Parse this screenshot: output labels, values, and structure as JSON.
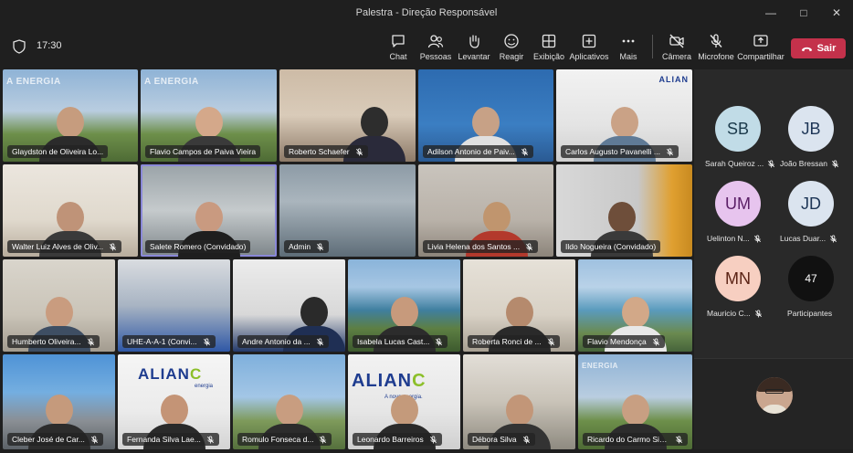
{
  "window": {
    "title": "Palestra - Direção Responsável"
  },
  "toolbar": {
    "time": "17:30",
    "buttons": {
      "chat": "Chat",
      "people": "Pessoas",
      "raise": "Levantar",
      "react": "Reagir",
      "view": "Exibição",
      "apps": "Aplicativos",
      "more": "Mais",
      "camera": "Câmera",
      "mic": "Microfone",
      "share": "Compartilhar"
    },
    "leave_label": "Sair"
  },
  "colors": {
    "accent": "#8a88d8",
    "leave": "#c4314b",
    "muted_mic": "#ffffff"
  },
  "tiles": [
    {
      "name": "Glaydston de Oliveira Lo..."
    },
    {
      "name": "Flavio Campos de Paiva Vieira"
    },
    {
      "name": "Roberto Schaefer"
    },
    {
      "name": "Adilson Antonio de Paiv..."
    },
    {
      "name": "Carlos Augusto Pavanelli ..."
    },
    {
      "name": "Walter Luiz Alves de Oliv..."
    },
    {
      "name": "Salete Romero (Convidado)"
    },
    {
      "name": "Admin"
    },
    {
      "name": "Livia Helena dos Santos ..."
    },
    {
      "name": "Ildo Nogueira (Convidado)"
    },
    {
      "name": "Humberto Oliveira..."
    },
    {
      "name": "UHE-A-A-1 (Convi..."
    },
    {
      "name": "Andre Antonio da ..."
    },
    {
      "name": "Isabela Lucas Cast..."
    },
    {
      "name": "Roberta Ronci de ..."
    },
    {
      "name": "Flavio Mendonça"
    },
    {
      "name": "Cleber José de Car..."
    },
    {
      "name": "Fernanda Silva Lae..."
    },
    {
      "name": "Romulo Fonseca d..."
    },
    {
      "name": "Leonardo Barreiros"
    },
    {
      "name": "Débora Silva"
    },
    {
      "name": "Ricardo do Carmo Siqu..."
    }
  ],
  "backgrounds": {
    "energia_top": "A ENERGIA",
    "energia_small": "ENERGIA",
    "aliance": "ALIAN",
    "aliance_mark": "C",
    "aliance_sub": "energia",
    "aliance_tagline": "A nova energia."
  },
  "roster": [
    {
      "initials": "SB",
      "name": "Sarah Queiroz ..."
    },
    {
      "initials": "JB",
      "name": "João Bressan"
    },
    {
      "initials": "UM",
      "name": "Uelinton N..."
    },
    {
      "initials": "JD",
      "name": "Lucas Duar..."
    },
    {
      "initials": "MN",
      "name": "Mauricio C..."
    }
  ],
  "participants": {
    "count": "47",
    "label": "Participantes"
  }
}
